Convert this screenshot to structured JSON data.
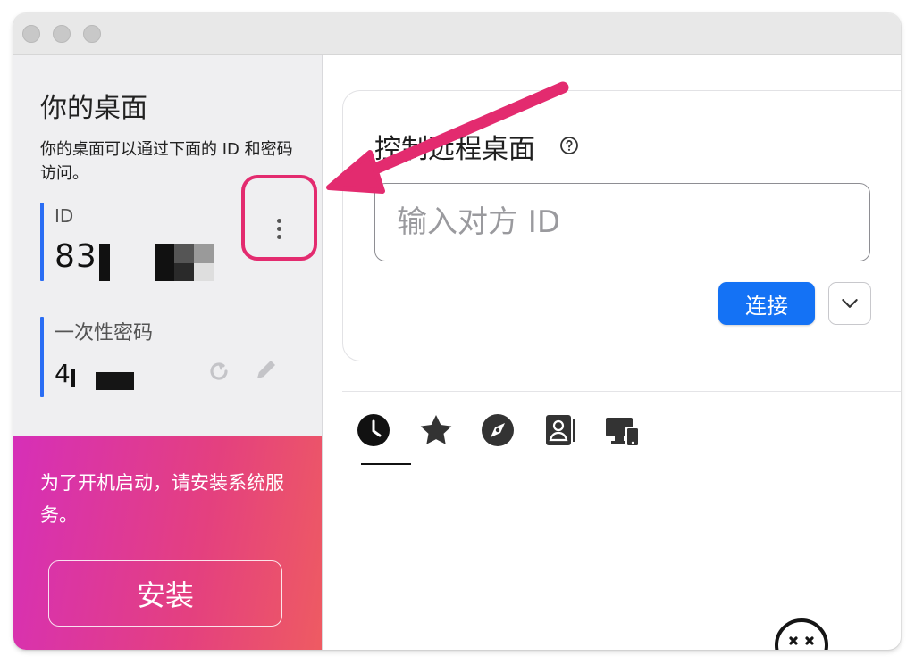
{
  "window": {
    "traffic_lights": [
      "close",
      "minimize",
      "zoom"
    ]
  },
  "sidebar": {
    "title": "你的桌面",
    "description": "你的桌面可以通过下面的 ID 和密码访问。",
    "id_label": "ID",
    "id_value": "83",
    "password_label": "一次性密码",
    "password_value": "4",
    "promo_text": "为了开机启动，请安装系统服务。",
    "install_label": "安装"
  },
  "main": {
    "card_title": "控制远程桌面",
    "id_input_placeholder": "输入对方 ID",
    "id_input_value": "",
    "connect_label": "连接",
    "tabs": [
      {
        "name": "recent",
        "icon": "clock-icon",
        "active": true
      },
      {
        "name": "favorites",
        "icon": "star-icon",
        "active": false
      },
      {
        "name": "discovered",
        "icon": "compass-icon",
        "active": false
      },
      {
        "name": "address-book",
        "icon": "address-book-icon",
        "active": false
      },
      {
        "name": "devices",
        "icon": "devices-icon",
        "active": false
      }
    ]
  },
  "colors": {
    "accent": "#1472f5",
    "highlight": "#e32b6f",
    "sidebar_bar": "#2a6df4",
    "promo_gradient": [
      "#d62fb8",
      "#ee5b62"
    ]
  }
}
